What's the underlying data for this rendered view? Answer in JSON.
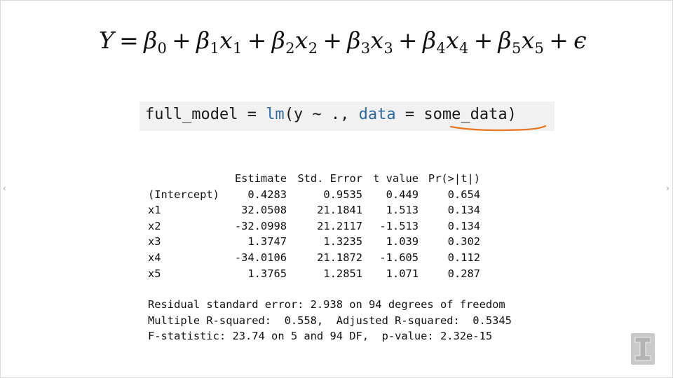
{
  "equation": {
    "lhs": "Y",
    "terms": [
      {
        "coef": "β",
        "coef_sub": "0",
        "var": "",
        "var_sub": ""
      },
      {
        "coef": "β",
        "coef_sub": "1",
        "var": "x",
        "var_sub": "1"
      },
      {
        "coef": "β",
        "coef_sub": "2",
        "var": "x",
        "var_sub": "2"
      },
      {
        "coef": "β",
        "coef_sub": "3",
        "var": "x",
        "var_sub": "3"
      },
      {
        "coef": "β",
        "coef_sub": "4",
        "var": "x",
        "var_sub": "4"
      },
      {
        "coef": "β",
        "coef_sub": "5",
        "var": "x",
        "var_sub": "5"
      }
    ],
    "error": "ϵ"
  },
  "code": {
    "assign": "full_model = ",
    "fn": "lm",
    "args_open": "(y ~ ., ",
    "kw": "data",
    "eq": " = ",
    "arg": "some_data",
    "close": ")",
    "underline_color": "#e8761f"
  },
  "regression": {
    "headers": [
      "",
      "Estimate",
      "Std. Error",
      "t value",
      "Pr(>|t|)"
    ],
    "rows": [
      [
        "(Intercept)",
        "0.4283",
        "0.9535",
        "0.449",
        "0.654"
      ],
      [
        "x1",
        "32.0508",
        "21.1841",
        "1.513",
        "0.134"
      ],
      [
        "x2",
        "-32.0998",
        "21.2117",
        "-1.513",
        "0.134"
      ],
      [
        "x3",
        "1.3747",
        "1.3235",
        "1.039",
        "0.302"
      ],
      [
        "x4",
        "-34.0106",
        "21.1872",
        "-1.605",
        "0.112"
      ],
      [
        "x5",
        "1.3765",
        "1.2851",
        "1.071",
        "0.287"
      ]
    ],
    "summary": [
      "Residual standard error: 2.938 on 94 degrees of freedom",
      "Multiple R-squared:  0.558,  Adjusted R-squared:  0.5345",
      "F-statistic: 23.74 on 5 and 94 DF,  p-value: 2.32e-15"
    ]
  },
  "nav": {
    "prev_icon": "chevron-left-icon",
    "prev_glyph": "‹",
    "next_icon": "chevron-right-icon",
    "next_glyph": "›"
  },
  "logo": {
    "icon": "university-block-i-logo",
    "color": "#c9c9c9"
  }
}
